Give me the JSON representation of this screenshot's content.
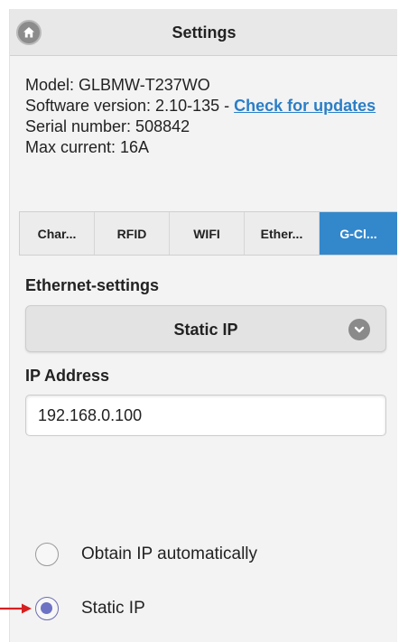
{
  "header": {
    "title": "Settings",
    "home_icon": "home-icon"
  },
  "device_info": {
    "model": "Model: GLBMW-T237WO",
    "software_version": "Software version: 2.10-135 - ",
    "check_updates_link": "Check for updates",
    "serial_number": "Serial number: 508842",
    "max_current": "Max current: 16A"
  },
  "tabs": [
    {
      "label": "Char...",
      "active": false
    },
    {
      "label": "RFID",
      "active": false
    },
    {
      "label": "WIFI",
      "active": false
    },
    {
      "label": "Ether...",
      "active": false
    },
    {
      "label": "G-Cl...",
      "active": true
    }
  ],
  "ethernet": {
    "section_title": "Ethernet-settings",
    "mode_select": {
      "selected": "Static IP",
      "icon": "chevron-down-icon"
    },
    "ip_label": "IP Address",
    "ip_value": "192.168.0.100"
  },
  "radio_options": [
    {
      "label": "Obtain IP automatically",
      "checked": false
    },
    {
      "label": "Static IP",
      "checked": true
    }
  ],
  "colors": {
    "accent_tab": "#3388cc",
    "link": "#2a7ec8",
    "radio_checked": "#6e72c4",
    "annotation_arrow": "#d62020"
  }
}
